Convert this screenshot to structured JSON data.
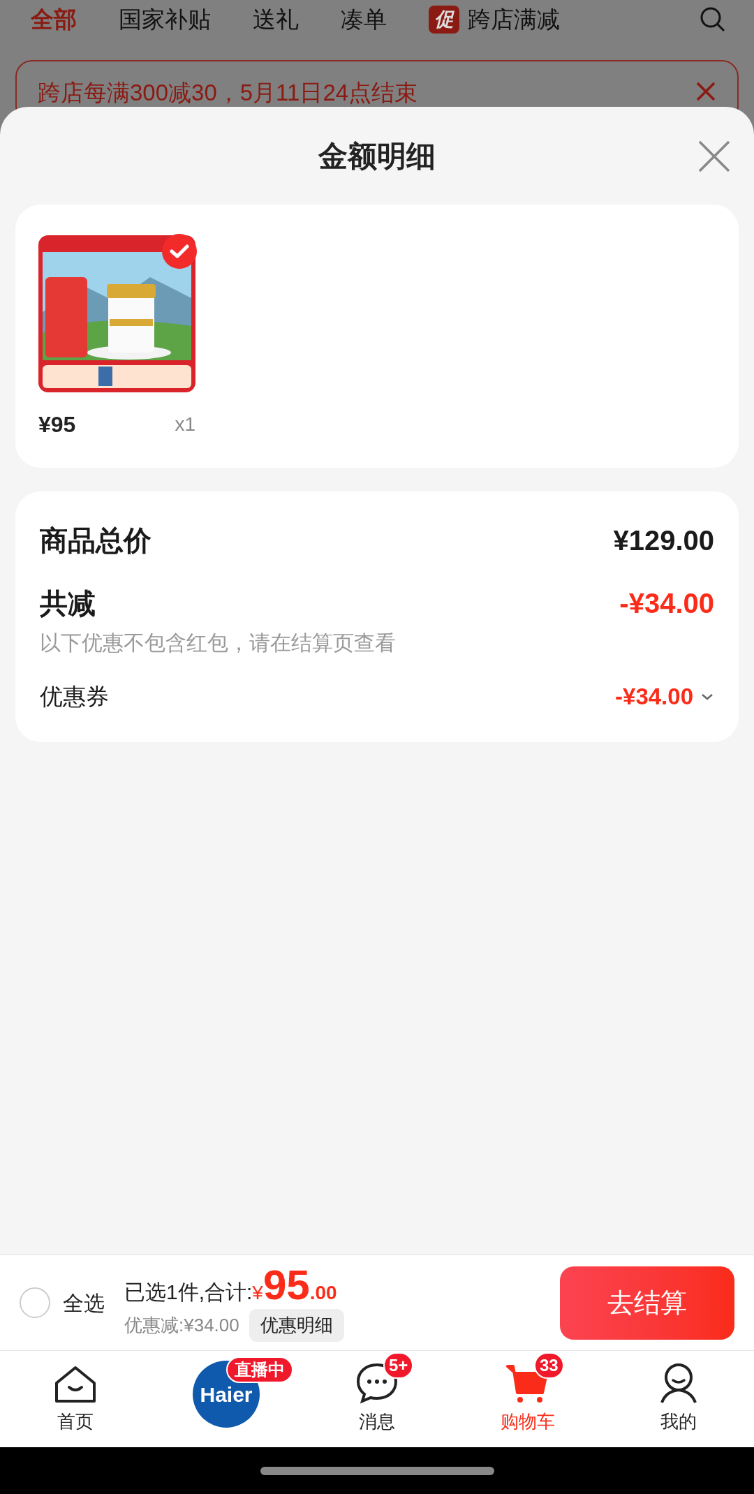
{
  "top_tabs": [
    {
      "label": "全部",
      "selected": true
    },
    {
      "label": "国家补贴",
      "selected": false
    },
    {
      "label": "送礼",
      "selected": false
    },
    {
      "label": "凑单",
      "selected": false
    },
    {
      "label": "跨店满减",
      "selected": false,
      "badge": "促"
    }
  ],
  "promo_banner": {
    "text": "跨店每满300减30，5月11日24点结束"
  },
  "sheet": {
    "title": "金额明细"
  },
  "products": [
    {
      "kind": "picture",
      "selected": true,
      "price": "¥95",
      "quantity": "x1"
    }
  ],
  "summary": [
    {
      "kind": "total",
      "label": "商品总价",
      "value": "¥129.00"
    },
    {
      "kind": "discount",
      "label": "共减",
      "value": "-¥34.00",
      "note": "以下优惠不包含红包，请在结算页查看"
    },
    {
      "kind": "coupon",
      "label": "优惠券",
      "value": "-¥34.00",
      "expanded": false
    }
  ],
  "checkout_bar": {
    "select_all": {
      "label": "全选",
      "checked": false
    },
    "selected_text": "已选1件,合计:",
    "currency": "¥",
    "total_integer": "95",
    "total_decimal": ".00",
    "discount_text": "优惠减:¥34.00",
    "detail_button": "优惠明细",
    "checkout_button": "去结算"
  },
  "bottom_nav": [
    {
      "kind": "home",
      "label": "首页",
      "selected": false
    },
    {
      "kind": "live",
      "logo": "Haier",
      "badge": "直播中"
    },
    {
      "kind": "message",
      "label": "消息",
      "badge": "5+",
      "selected": false
    },
    {
      "kind": "cart",
      "label": "购物车",
      "badge": "33",
      "selected": true
    },
    {
      "kind": "profile",
      "label": "我的",
      "selected": false
    }
  ]
}
